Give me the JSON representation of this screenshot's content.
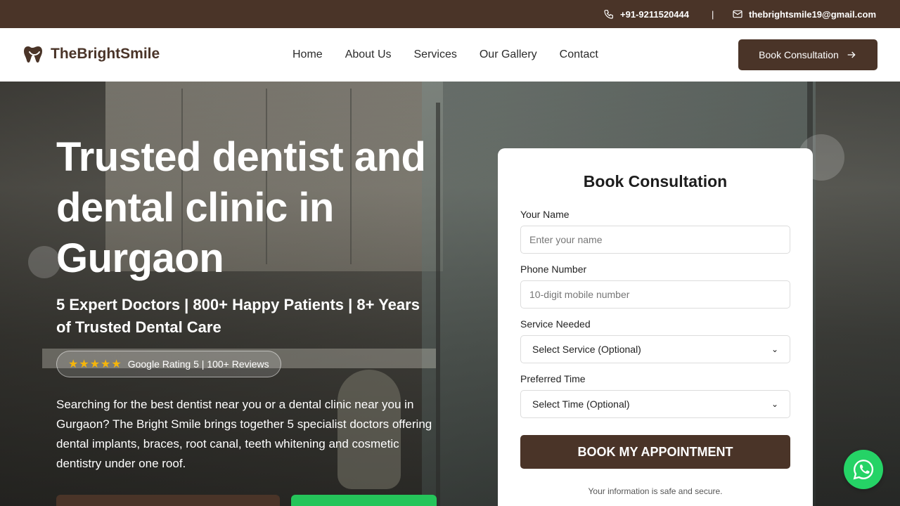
{
  "topbar": {
    "phone": "+91-9211520444",
    "separator": "|",
    "email": "thebrightsmile19@gmail.com"
  },
  "nav": {
    "brand": "TheBrightSmile",
    "links": [
      "Home",
      "About Us",
      "Services",
      "Our Gallery",
      "Contact"
    ],
    "cta_label": "Book Consultation"
  },
  "hero": {
    "title": "Trusted dentist and dental clinic in Gurgaon",
    "subtitle": "5 Expert Doctors | 800+ Happy Patients | 8+ Years of Trusted Dental Care",
    "stars": "★★★★★",
    "rating_text": "Google Rating 5 | 100+ Reviews",
    "description": "Searching for the best dentist near you or a dental clinic near you in Gurgaon? The Bright Smile brings together 5 specialist doctors offering dental implants, braces, root canal, teeth whitening and cosmetic dentistry under one roof."
  },
  "form": {
    "title": "Book Consultation",
    "name_label": "Your Name",
    "name_placeholder": "Enter your name",
    "phone_label": "Phone Number",
    "phone_placeholder": "10-digit mobile number",
    "service_label": "Service Needed",
    "service_selected": "Select Service (Optional)",
    "time_label": "Preferred Time",
    "time_selected": "Select Time (Optional)",
    "submit_label": "BOOK MY APPOINTMENT",
    "secure_note": "Your information is safe and secure."
  },
  "colors": {
    "brand_brown": "#4a3428",
    "whatsapp_green": "#25d366",
    "star_gold": "#f5b50a"
  },
  "icons": {
    "phone": "phone-icon",
    "email": "mail-icon",
    "logo": "tooth-logo-icon",
    "cta_arrow": "arrow-right-icon",
    "whatsapp": "whatsapp-icon"
  }
}
